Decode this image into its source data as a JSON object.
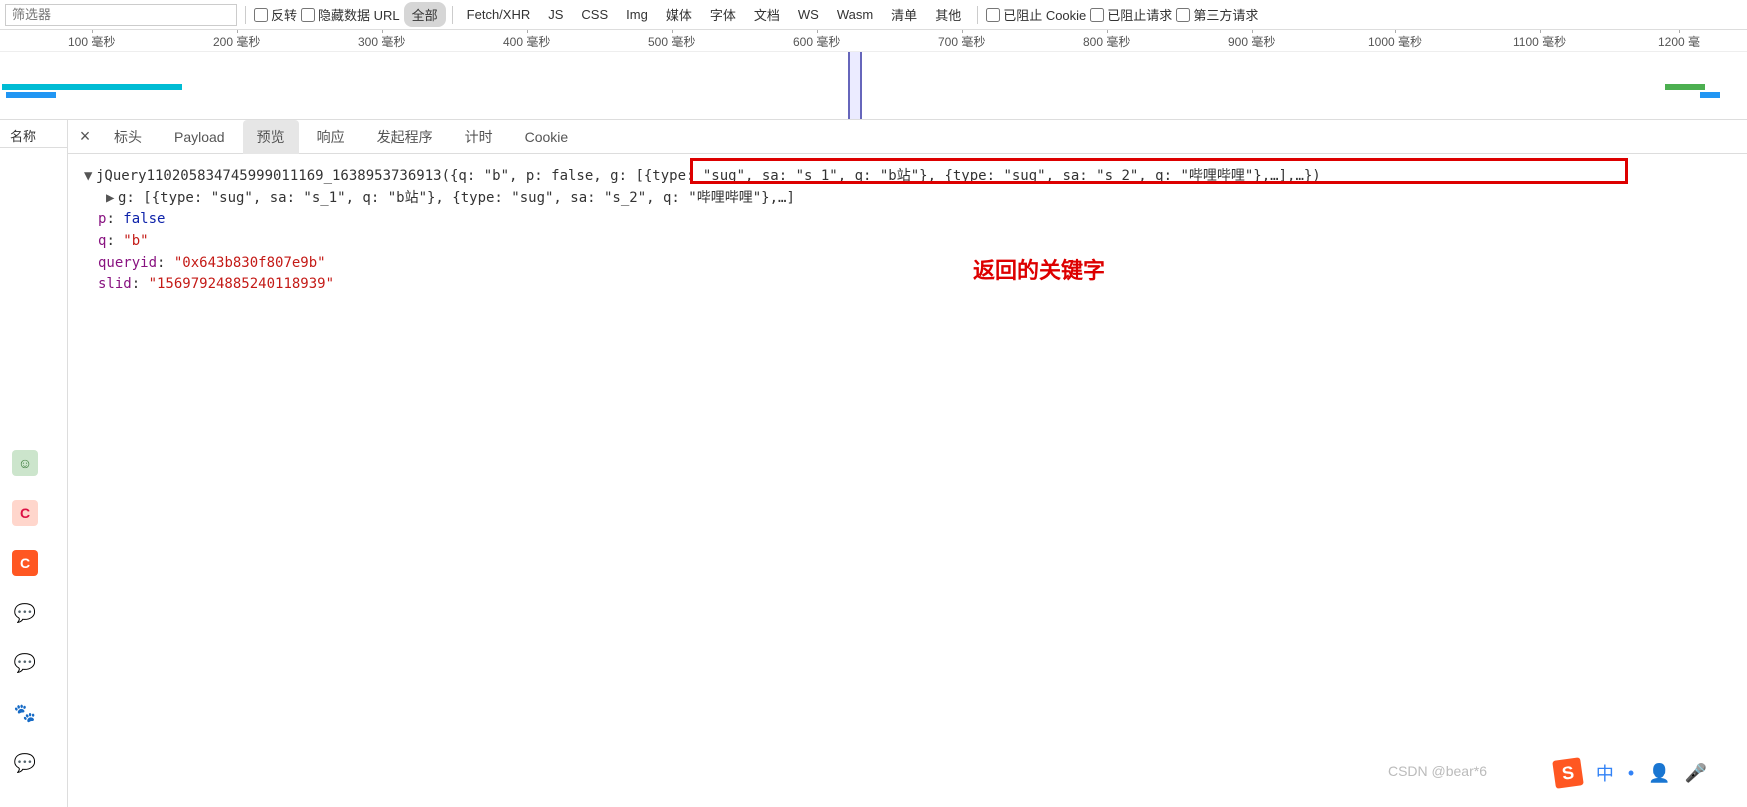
{
  "toolbar": {
    "filter_placeholder": "筛选器",
    "invert": "反转",
    "hide_data": "隐藏数据 URL",
    "types": [
      "全部",
      "Fetch/XHR",
      "JS",
      "CSS",
      "Img",
      "媒体",
      "字体",
      "文档",
      "WS",
      "Wasm",
      "清单",
      "其他"
    ],
    "blocked_cookie": "已阻止 Cookie",
    "blocked_req": "已阻止请求",
    "third_party": "第三方请求"
  },
  "timeline": {
    "ticks": [
      "100 毫秒",
      "200 毫秒",
      "300 毫秒",
      "400 毫秒",
      "500 毫秒",
      "600 毫秒",
      "700 毫秒",
      "800 毫秒",
      "900 毫秒",
      "1000 毫秒",
      "1100 毫秒",
      "1200 毫"
    ]
  },
  "panel": {
    "name_header": "名称",
    "tabs": [
      "标头",
      "Payload",
      "预览",
      "响应",
      "发起程序",
      "计时",
      "Cookie"
    ],
    "active_tab": "预览"
  },
  "preview": {
    "root": "jQuery110205834745999011169_1638953736913({q: \"b\", p: false, g: [{type: \"sug\", sa: \"s_1\", q: \"b站\"}, {type: \"sug\", sa: \"s_2\", q: \"哔哩哔哩\"},…],…})",
    "g_line": "g: [{type: \"sug\", sa: \"s_1\", q: \"b站\"}, {type: \"sug\", sa: \"s_2\", q: \"哔哩哔哩\"},…]",
    "p_key": "p",
    "p_val": "false",
    "q_key": "q",
    "q_val": "\"b\"",
    "queryid_key": "queryid",
    "queryid_val": "\"0x643b830f807e9b\"",
    "slid_key": "slid",
    "slid_val": "\"15697924885240118939\""
  },
  "annotation": {
    "label": "返回的关键字"
  },
  "watermark": "CSDN @bear*6"
}
